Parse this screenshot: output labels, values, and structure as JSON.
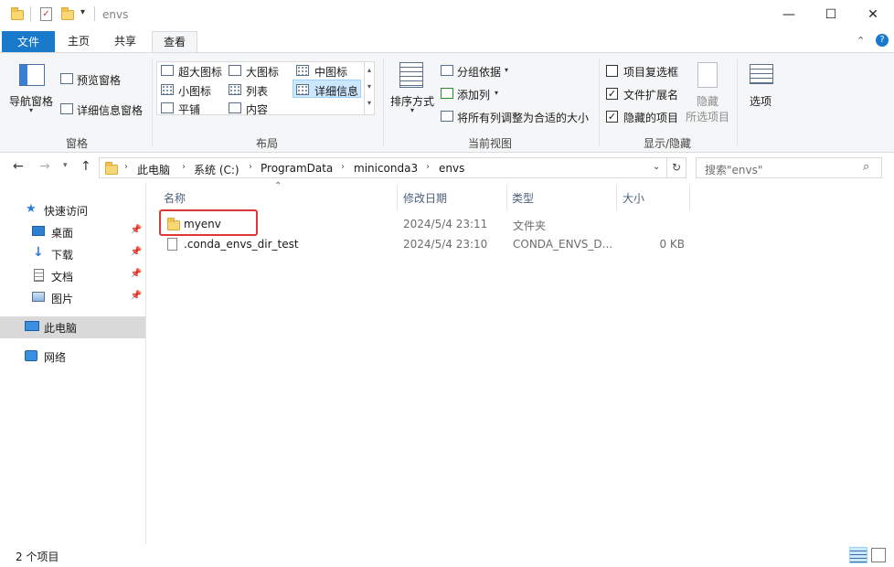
{
  "window": {
    "title": "envs",
    "controls": {
      "minimize": "—",
      "maximize": "☐",
      "close": "✕"
    }
  },
  "ribbon_tabs": [
    {
      "label": "文件",
      "active": false
    },
    {
      "label": "主页",
      "active": false
    },
    {
      "label": "共享",
      "active": false
    },
    {
      "label": "查看",
      "active": true
    }
  ],
  "ribbon": {
    "panes": {
      "group_label": "窗格",
      "nav_pane": "导航窗格",
      "preview_pane": "预览窗格",
      "details_pane": "详细信息窗格"
    },
    "layout": {
      "group_label": "布局",
      "options": [
        "超大图标",
        "大图标",
        "中图标",
        "小图标",
        "列表",
        "详细信息",
        "平铺",
        "内容"
      ],
      "selected": "详细信息"
    },
    "current_view": {
      "group_label": "当前视图",
      "sort": "排序方式",
      "group_by": "分组依据",
      "add_column": "添加列",
      "fit_columns": "将所有列调整为合适的大小"
    },
    "show_hide": {
      "group_label": "显示/隐藏",
      "item_checkboxes": {
        "label": "项目复选框",
        "checked": false
      },
      "file_extensions": {
        "label": "文件扩展名",
        "checked": true
      },
      "hidden_items": {
        "label": "隐藏的项目",
        "checked": true
      },
      "hide_selected_1": "隐藏",
      "hide_selected_2": "所选项目"
    },
    "options": {
      "label": "选项"
    }
  },
  "address": {
    "crumbs": [
      "此电脑",
      "系统 (C:)",
      "ProgramData",
      "miniconda3",
      "envs"
    ],
    "search_placeholder": "搜索\"envs\""
  },
  "nav_pane": {
    "quick_access": "快速访问",
    "pinned": [
      "桌面",
      "下载",
      "文档",
      "图片"
    ],
    "this_pc": "此电脑",
    "network": "网络"
  },
  "columns": {
    "name": "名称",
    "modified": "修改日期",
    "type": "类型",
    "size": "大小"
  },
  "files": [
    {
      "name": "myenv",
      "modified": "2024/5/4 23:11",
      "type": "文件夹",
      "size": "",
      "kind": "folder"
    },
    {
      "name": ".conda_envs_dir_test",
      "modified": "2024/5/4 23:10",
      "type": "CONDA_ENVS_D...",
      "size": "0 KB",
      "kind": "file"
    }
  ],
  "status": {
    "item_count": "2 个项目"
  },
  "colors": {
    "accent": "#1979ca",
    "highlight_box": "#e03535",
    "selected_nav": "#d9d9d9"
  }
}
